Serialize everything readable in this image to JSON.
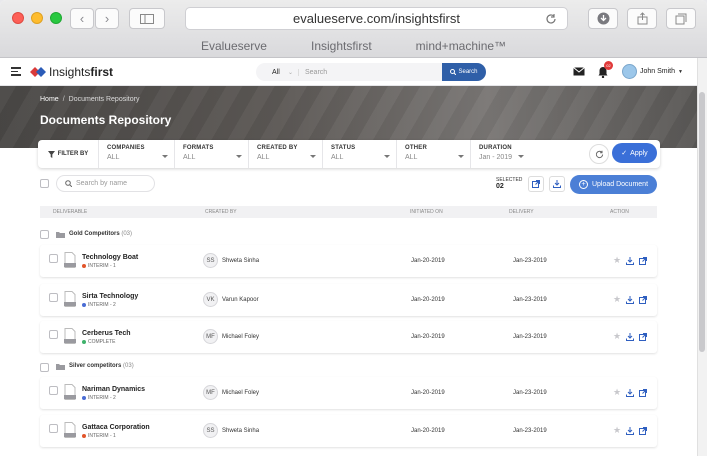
{
  "browser": {
    "url": "evalueserve.com/insightsfirst",
    "bookmarks": [
      "Evalueserve",
      "Insightsfirst",
      "mind+machine™"
    ]
  },
  "app": {
    "logo_text": "Insights",
    "logo_bold": "first",
    "search_scope": "All",
    "search_placeholder": "Search",
    "search_button": "Search",
    "notif_count": "02",
    "user": "John Smith"
  },
  "hero": {
    "breadcrumb_home": "Home",
    "breadcrumb_sep": "/",
    "breadcrumb_current": "Documents Repository",
    "title": "Documents Repository"
  },
  "filters": {
    "label": "FILTER BY",
    "cols": [
      {
        "label": "COMPANIES",
        "value": "ALL"
      },
      {
        "label": "FORMATS",
        "value": "ALL"
      },
      {
        "label": "CREATED BY",
        "value": "ALL"
      },
      {
        "label": "STATUS",
        "value": "ALL"
      },
      {
        "label": "OTHER",
        "value": "ALL"
      },
      {
        "label": "DURATION",
        "value": "Jan - 2019"
      }
    ],
    "apply": "Apply"
  },
  "toolbar": {
    "search_placeholder": "Search by name",
    "selected_label": "SELECTED",
    "selected_count": "02",
    "upload": "Upload Document"
  },
  "table": {
    "headers": {
      "deliverable": "DELIVERABLE",
      "created_by": "CREATED BY",
      "initiated": "INITIATED ON",
      "delivery": "DELIVERY",
      "action": "ACTION"
    },
    "groups": [
      {
        "name": "Gold Competitors",
        "count": "(03)"
      },
      {
        "name": "Silver competitors",
        "count": "(03)"
      }
    ],
    "rows": [
      {
        "name": "Technology Boat",
        "status": "INTERIM - 1",
        "status_color": "#e2552b",
        "initials": "SS",
        "creator": "Shweta Sinha",
        "initiated": "Jan-20-2019",
        "delivery": "Jan-23-2019"
      },
      {
        "name": "Sirta Technology",
        "status": "INTERIM - 2",
        "status_color": "#4a6cd4",
        "initials": "VK",
        "creator": "Varun Kapoor",
        "initiated": "Jan-20-2019",
        "delivery": "Jan-23-2019"
      },
      {
        "name": "Cerberus Tech",
        "status": "COMPLETE",
        "status_color": "#3fb26b",
        "initials": "MF",
        "creator": "Michael Foley",
        "initiated": "Jan-20-2019",
        "delivery": "Jan-23-2019"
      },
      {
        "name": "Nariman Dynamics",
        "status": "INTERIM - 2",
        "status_color": "#4a6cd4",
        "initials": "MF",
        "creator": "Michael Foley",
        "initiated": "Jan-20-2019",
        "delivery": "Jan-23-2019"
      },
      {
        "name": "Gattaca Corporation",
        "status": "INTERIM - 1",
        "status_color": "#e2552b",
        "initials": "SS",
        "creator": "Shweta Sinha",
        "initiated": "Jan-20-2019",
        "delivery": "Jan-23-2019"
      }
    ]
  },
  "colors": {
    "accent": "#3a6fd8",
    "accent_dark": "#2f5fc0",
    "hero": "#5a5754"
  }
}
